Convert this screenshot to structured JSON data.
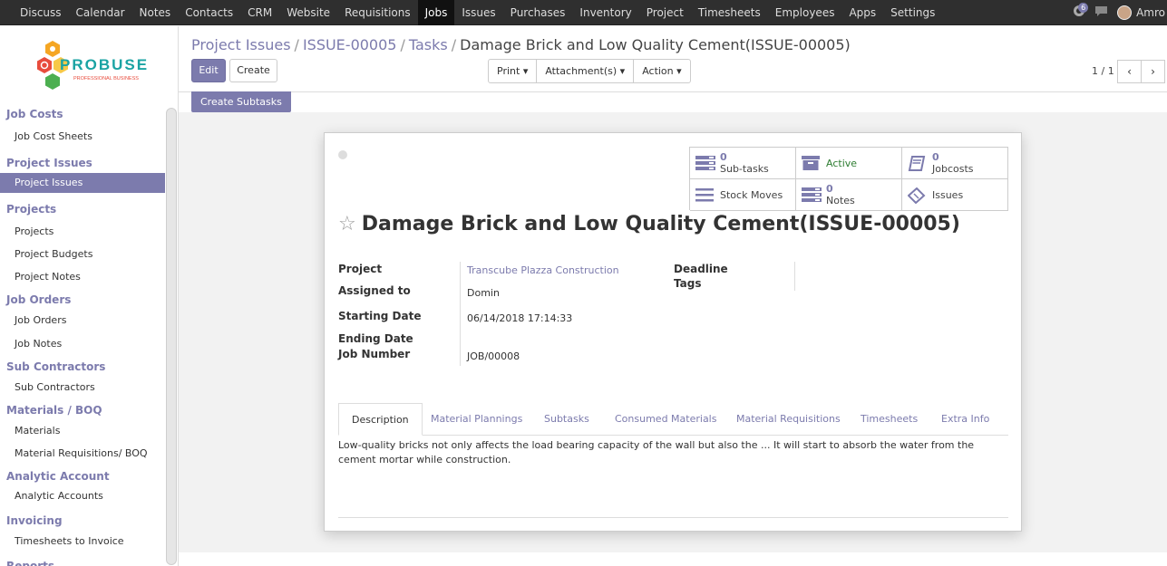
{
  "topbar": {
    "menu": [
      "Discuss",
      "Calendar",
      "Notes",
      "Contacts",
      "CRM",
      "Website",
      "Requisitions",
      "Jobs",
      "Issues",
      "Purchases",
      "Inventory",
      "Project",
      "Timesheets",
      "Employees",
      "Apps",
      "Settings"
    ],
    "active_index": 7,
    "notification_count": "6",
    "user_name": "Amro"
  },
  "sidebar": {
    "logo_text": "PROBUSE",
    "logo_subtext": "PROFESSIONAL BUSINESS",
    "sections": [
      {
        "title": "Job Costs",
        "items": [
          "Job Cost Sheets"
        ]
      },
      {
        "title": "Project Issues",
        "items": [
          "Project Issues"
        ]
      },
      {
        "title": "Projects",
        "items": [
          "Projects",
          "Project Budgets",
          "Project Notes"
        ]
      },
      {
        "title": "Job Orders",
        "items": [
          "Job Orders",
          "Job Notes"
        ]
      },
      {
        "title": "Sub Contractors",
        "items": [
          "Sub Contractors"
        ]
      },
      {
        "title": "Materials / BOQ",
        "items": [
          "Materials",
          "Material Requisitions/ BOQ"
        ]
      },
      {
        "title": "Analytic Account",
        "items": [
          "Analytic Accounts"
        ]
      },
      {
        "title": "Invoicing",
        "items": [
          "Timesheets to Invoice"
        ]
      },
      {
        "title": "Reports",
        "items": []
      }
    ],
    "active_item": "Project Issues"
  },
  "breadcrumb": {
    "items": [
      "Project Issues",
      "ISSUE-00005",
      "Tasks"
    ],
    "current": "Damage Brick and Low Quality Cement(ISSUE-00005)",
    "separator": "/"
  },
  "buttons": {
    "edit": "Edit",
    "create": "Create",
    "print": "Print",
    "attachments": "Attachment(s)",
    "action": "Action",
    "create_subtasks": "Create Subtasks"
  },
  "pager": {
    "value": "1 / 1",
    "prev": "‹",
    "next": "›"
  },
  "smart_buttons": {
    "subtasks": {
      "count": "0",
      "label": "Sub-tasks"
    },
    "active": {
      "label": "Active"
    },
    "jobcosts": {
      "count": "0",
      "label": "Jobcosts"
    },
    "stock_moves": {
      "label": "Stock Moves"
    },
    "notes": {
      "count": "0",
      "label": "Notes"
    },
    "issues": {
      "label": "Issues"
    }
  },
  "record": {
    "star": "☆",
    "title": "Damage Brick and Low Quality Cement(ISSUE-00005)",
    "fields": {
      "project_label": "Project",
      "project_value": "Transcube Plazza Construction",
      "assigned_label": "Assigned to",
      "assigned_value": "Domin",
      "starting_label": "Starting Date",
      "starting_value": "06/14/2018 17:14:33",
      "ending_label": "Ending Date",
      "job_number_label": "Job Number",
      "job_number_value": "JOB/00008",
      "deadline_label": "Deadline",
      "tags_label": "Tags"
    }
  },
  "notebook": {
    "tabs": [
      "Description",
      "Material Plannings",
      "Subtasks",
      "Consumed Materials",
      "Material Requisitions",
      "Timesheets",
      "Extra Info"
    ],
    "active": "Description",
    "description": "Low-quality bricks not only affects the load bearing capacity of the wall but also the ... It will start to absorb the water from the cement mortar while construction."
  },
  "colors": {
    "accent": "#7c7bad",
    "topbar": "#2f2f2f",
    "active_status": "#2e7d32"
  }
}
